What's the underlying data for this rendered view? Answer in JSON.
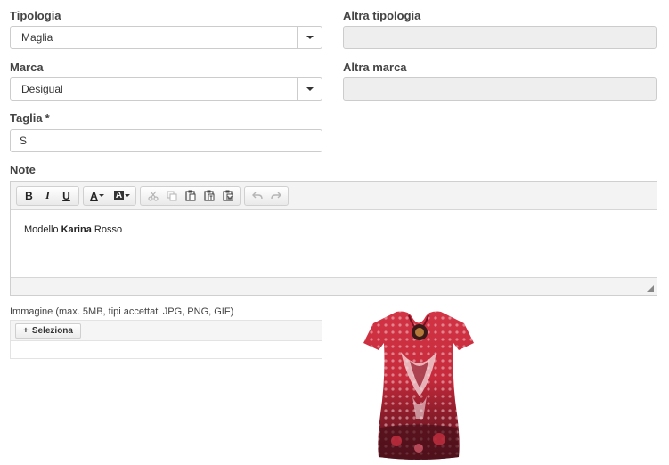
{
  "tipologia": {
    "label": "Tipologia",
    "value": "Maglia"
  },
  "altra_tipologia": {
    "label": "Altra tipologia",
    "value": ""
  },
  "marca": {
    "label": "Marca",
    "value": "Desigual"
  },
  "altra_marca": {
    "label": "Altra marca",
    "value": ""
  },
  "taglia": {
    "label": "Taglia",
    "required_mark": "*",
    "value": "S"
  },
  "note": {
    "label": "Note",
    "toolbar": {
      "bold": "B",
      "italic": "I",
      "underline": "U",
      "text_color": "A",
      "bg_color": "A"
    },
    "content": {
      "prefix": "Modello ",
      "bold": "Karina",
      "suffix": " Rosso"
    }
  },
  "immagine": {
    "label": "Immagine (max. 5MB, tipi accettati JPG, PNG, GIF)",
    "select_button": "Seleziona",
    "plus_icon": "+"
  },
  "colors": {
    "shirt_primary": "#c8283a",
    "shirt_dark": "#5a1420",
    "disabled_bg": "#eeeeee"
  }
}
